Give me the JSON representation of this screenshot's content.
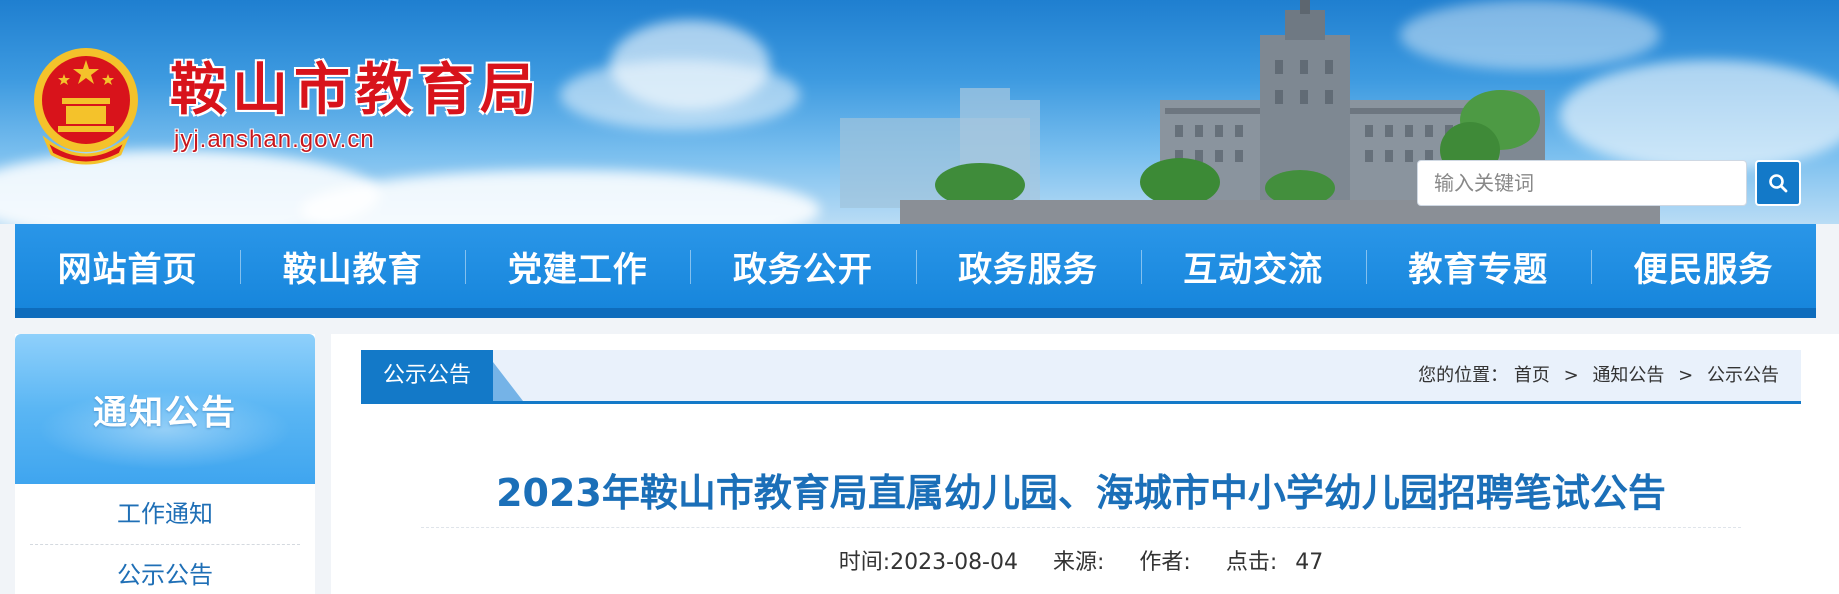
{
  "header": {
    "site_name": "鞍山市教育局",
    "site_url": "jyj.anshan.gov.cn",
    "emblem_icon": "national-emblem-icon"
  },
  "search": {
    "placeholder": "输入关键词",
    "button_icon": "search-icon"
  },
  "nav": {
    "items": [
      {
        "label": "网站首页"
      },
      {
        "label": "鞍山教育"
      },
      {
        "label": "党建工作"
      },
      {
        "label": "政务公开"
      },
      {
        "label": "政务服务"
      },
      {
        "label": "互动交流"
      },
      {
        "label": "教育专题"
      },
      {
        "label": "便民服务"
      }
    ]
  },
  "sidebar": {
    "title": "通知公告",
    "links": [
      {
        "label": "工作通知"
      },
      {
        "label": "公示公告"
      }
    ]
  },
  "breadcrumb": {
    "section_tab": "公示公告",
    "prefix": "您的位置：",
    "items": [
      "首页",
      "通知公告",
      "公示公告"
    ],
    "separator": ">"
  },
  "article": {
    "title": "2023年鞍山市教育局直属幼儿园、海城市中小学幼儿园招聘笔试公告",
    "time_label": "时间:",
    "time_value": "2023-08-04",
    "source_label": "来源:",
    "source_value": "",
    "author_label": "作者:",
    "author_value": "",
    "clicks_label": "点击:",
    "clicks_value": "47"
  },
  "colors": {
    "brand_red": "#d8131b",
    "nav_blue": "#1786dc",
    "accent_blue": "#1379c8",
    "title_blue": "#1b6fb8"
  }
}
